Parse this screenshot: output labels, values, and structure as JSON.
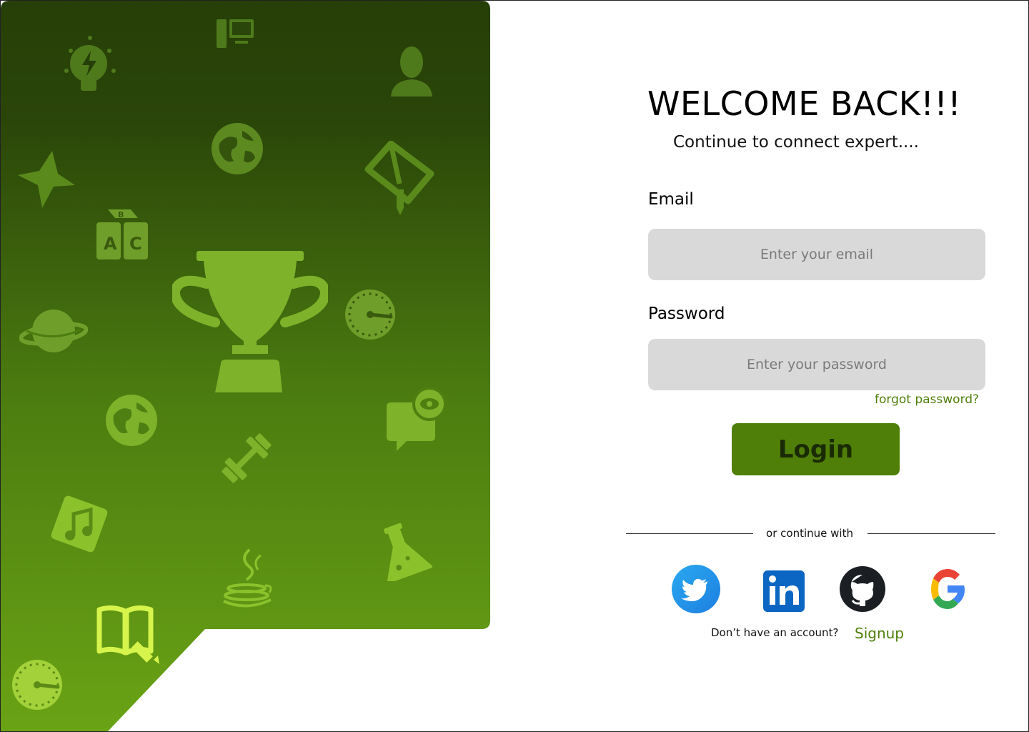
{
  "login": {
    "title": "WELCOME BACK!!!",
    "subtitle": "Continue to connect expert....",
    "email_label": "Email",
    "email_placeholder": "Enter your email",
    "email_value": "",
    "password_label": "Password",
    "password_placeholder": "Enter your password",
    "password_value": "",
    "forgot_label": "forgot password?",
    "login_label": "Login",
    "divider_text": "or continue with",
    "signup_prompt": "Don’t have an account?",
    "signup_label": "Signup"
  },
  "social_icons": [
    "twitter-icon",
    "linkedin-icon",
    "github-icon",
    "google-icon"
  ],
  "decor_icons": [
    "lightbulb-icon",
    "computer-icon",
    "person-icon",
    "globe-icon",
    "star-icon",
    "book-icon",
    "abc-blocks-icon",
    "trophy-icon",
    "planet-icon",
    "speedometer-icon",
    "chat-eye-icon",
    "dumbbell-icon",
    "music-note-icon",
    "flask-icon",
    "java-icon",
    "book-pencil-icon"
  ],
  "colors": {
    "panel_top": "#263f08",
    "panel_bottom": "#6aa315",
    "icon_fill": "#7eb22a",
    "accent_green": "#4f7f08",
    "link_green": "#4e7f0b",
    "input_bg": "#d9d9d9"
  }
}
